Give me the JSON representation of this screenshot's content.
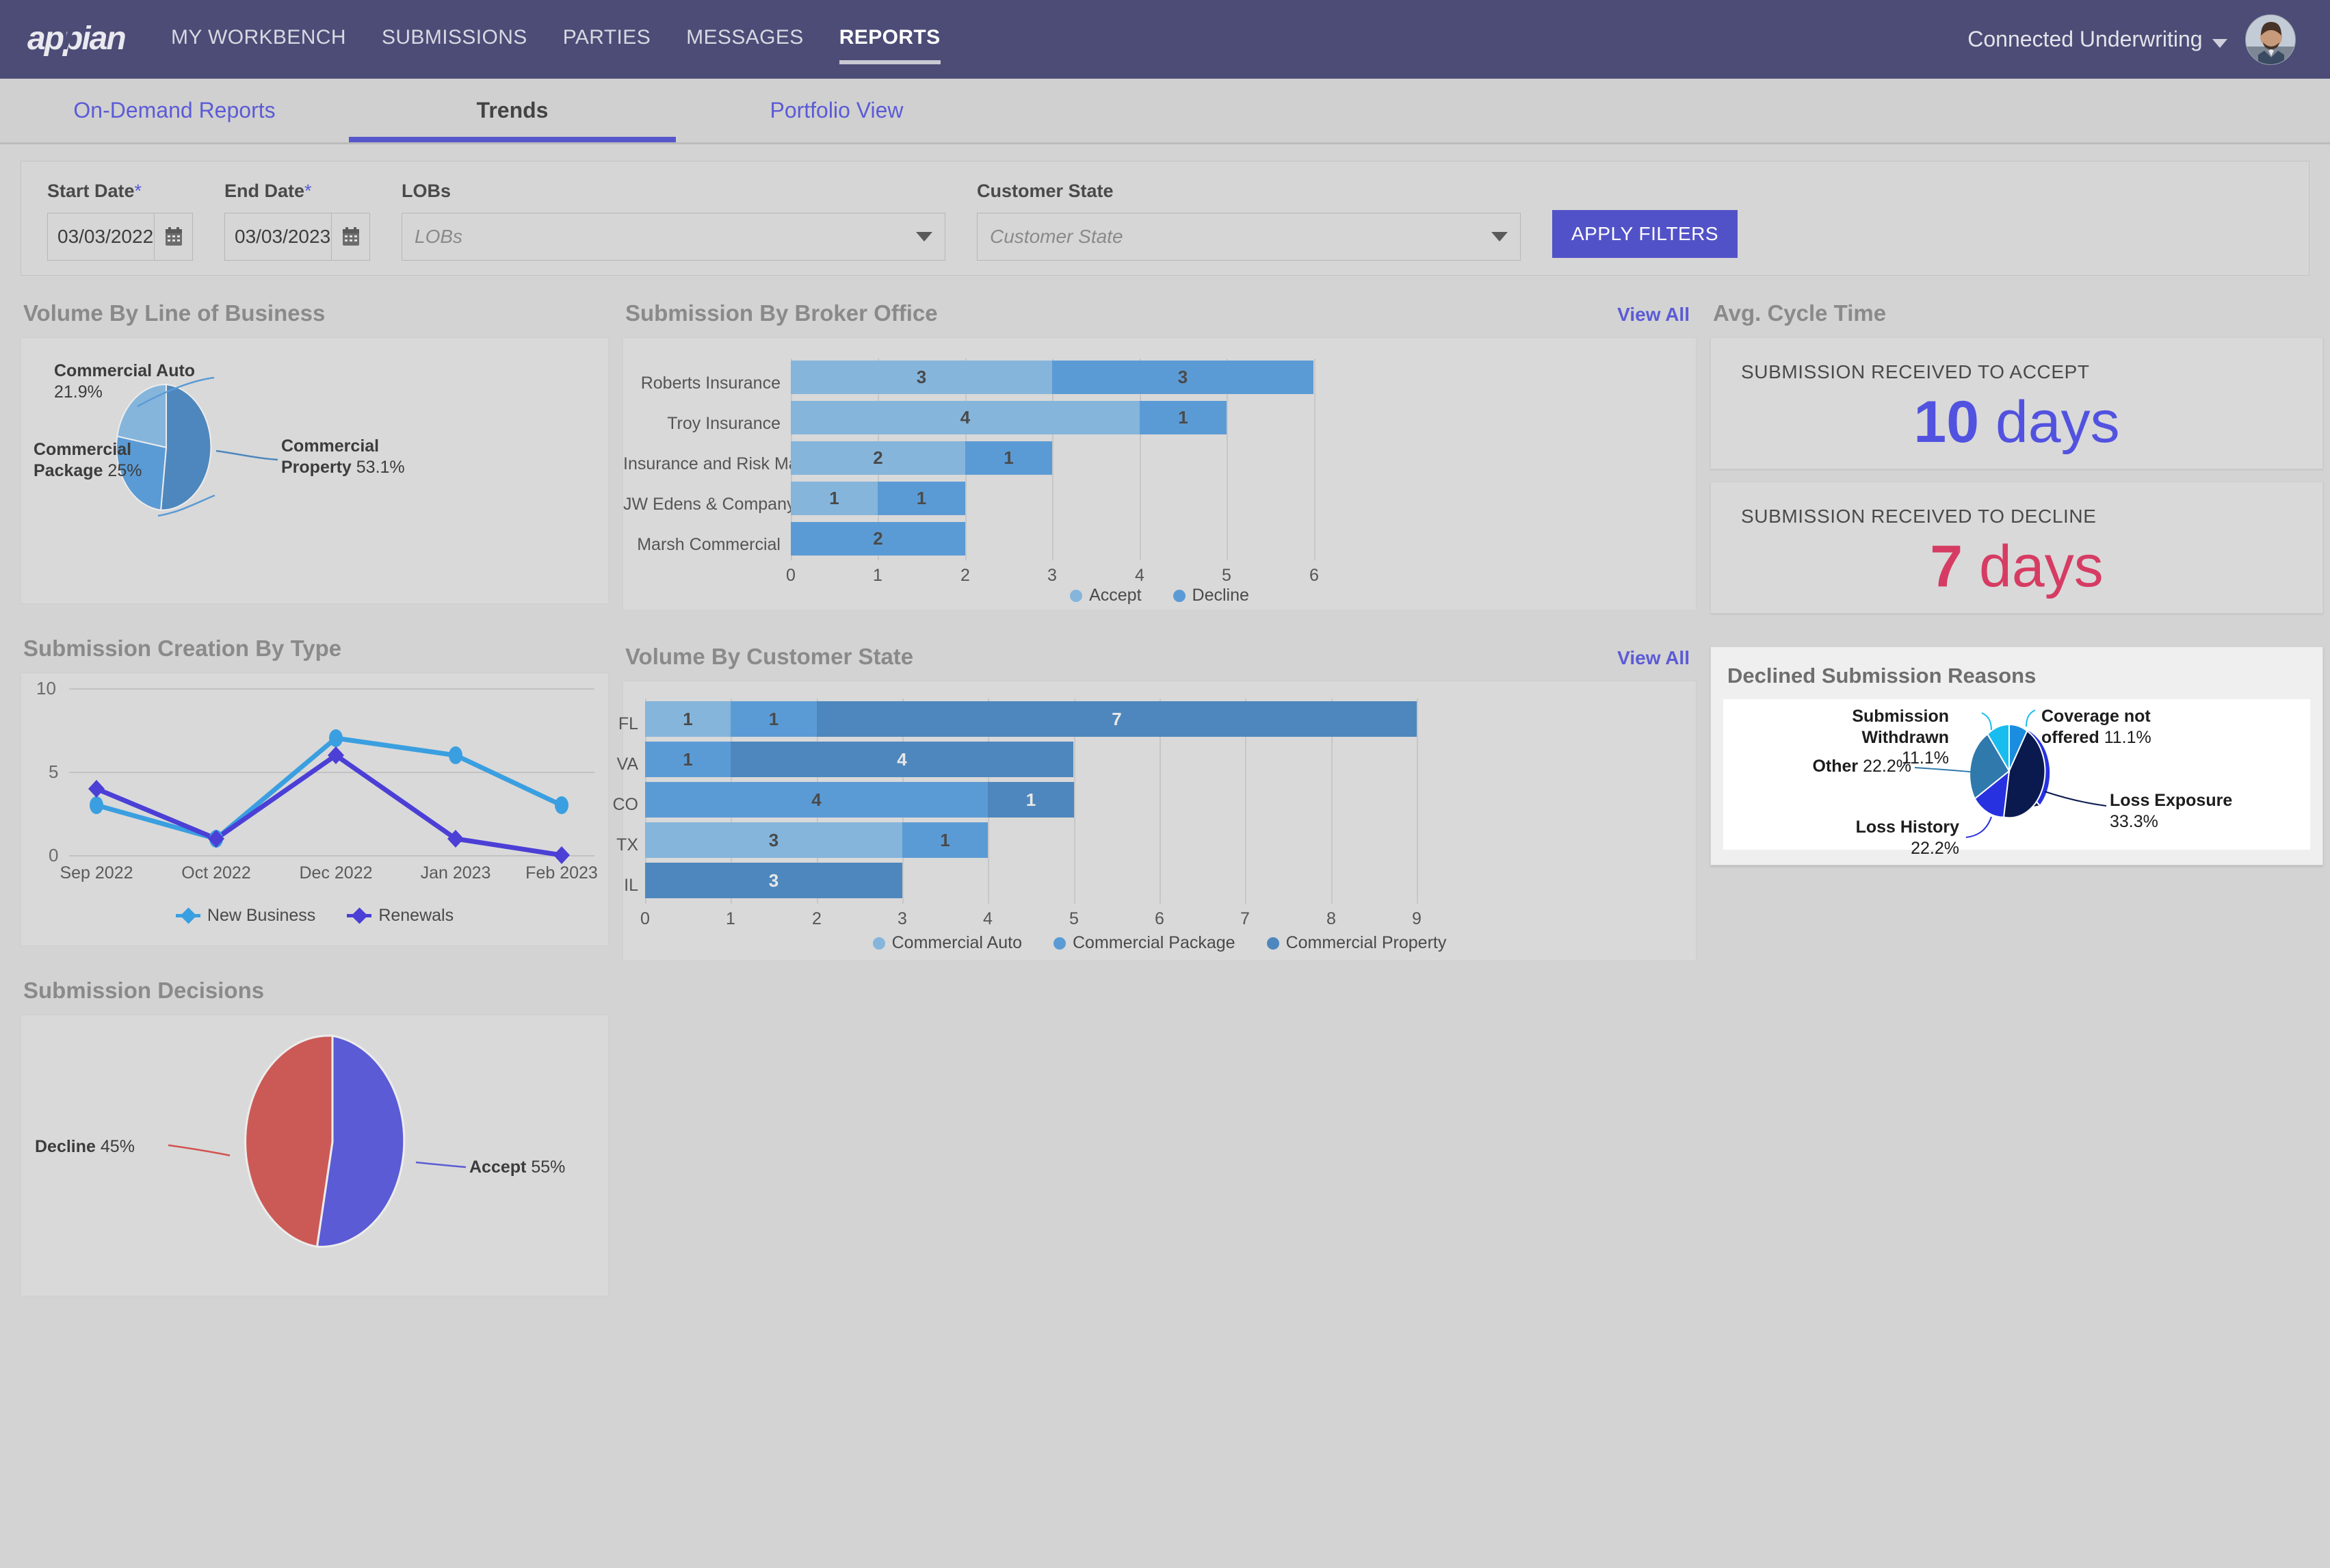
{
  "topnav": {
    "brand": "appian",
    "links": [
      {
        "label": "MY WORKBENCH",
        "active": false
      },
      {
        "label": "SUBMISSIONS",
        "active": false
      },
      {
        "label": "PARTIES",
        "active": false
      },
      {
        "label": "MESSAGES",
        "active": false
      },
      {
        "label": "REPORTS",
        "active": true
      }
    ],
    "org_name": "Connected Underwriting",
    "avatar_alt": "user-avatar"
  },
  "tabs": [
    {
      "label": "On-Demand Reports",
      "active": false
    },
    {
      "label": "Trends",
      "active": true
    },
    {
      "label": "Portfolio View",
      "active": false
    }
  ],
  "filters": {
    "start_date": {
      "label": "Start Date",
      "required": "*",
      "value": "03/03/2022"
    },
    "end_date": {
      "label": "End Date",
      "required": "*",
      "value": "03/03/2023"
    },
    "lobs": {
      "label": "LOBs",
      "placeholder": "LOBs",
      "value": ""
    },
    "customer_state": {
      "label": "Customer State",
      "placeholder": "Customer State",
      "value": ""
    },
    "apply_label": "APPLY FILTERS"
  },
  "cards": {
    "volume_lob": "Volume By Line of Business",
    "submission_creation": "Submission Creation By Type",
    "submission_decisions": "Submission Decisions",
    "broker_office": "Submission By Broker Office",
    "customer_state": "Volume By Customer State",
    "cycle_time": "Avg. Cycle Time",
    "declined_reasons": "Declined Submission Reasons",
    "view_all": "View All"
  },
  "kpis": [
    {
      "label": "SUBMISSION RECEIVED TO ACCEPT",
      "value": "10",
      "unit": "days",
      "color": "#5252e0"
    },
    {
      "label": "SUBMISSION RECEIVED TO DECLINE",
      "value": "7",
      "unit": "days",
      "color": "#d63c63"
    }
  ],
  "chart_data": [
    {
      "id": "volume_by_lob",
      "type": "pie",
      "title": "Volume By Line of Business",
      "labels": [
        "Commercial Property",
        "Commercial Package",
        "Commercial Auto"
      ],
      "values": [
        53.1,
        25,
        21.9
      ],
      "value_labels": [
        "53.1%",
        "25%",
        "21.9%"
      ],
      "colors": [
        "#4e87bd",
        "#5b9bd5",
        "#85b5db"
      ],
      "legend": "none"
    },
    {
      "id": "submission_creation_by_type",
      "type": "line",
      "title": "Submission Creation By Type",
      "x": [
        "Sep 2022",
        "Oct 2022",
        "Dec 2022",
        "Jan 2023",
        "Feb 2023"
      ],
      "series": [
        {
          "name": "New Business",
          "values": [
            3,
            1,
            7,
            6,
            3
          ],
          "color": "#3a9fe0"
        },
        {
          "name": "Renewals",
          "values": [
            4,
            1,
            6,
            1,
            0
          ],
          "color": "#4b3fd6"
        }
      ],
      "ylim": [
        0,
        10
      ],
      "yticks": [
        0,
        5,
        10
      ],
      "ylabel": "",
      "xlabel": "",
      "grid": true,
      "legend": "bottom"
    },
    {
      "id": "submission_decisions",
      "type": "pie",
      "title": "Submission Decisions",
      "labels": [
        "Accept",
        "Decline"
      ],
      "values": [
        55,
        45
      ],
      "value_labels": [
        "55%",
        "45%"
      ],
      "colors": [
        "#5b5bd6",
        "#cb5a56"
      ],
      "legend": "none"
    },
    {
      "id": "submission_by_broker_office",
      "type": "bar",
      "orientation": "horizontal",
      "stacked": true,
      "title": "Submission By Broker Office",
      "categories": [
        "Roberts Insurance",
        "Troy Insurance",
        "Insurance and Risk Management Services, Inc.",
        "JW Edens & Company",
        "Marsh Commercial"
      ],
      "series": [
        {
          "name": "Accept",
          "values": [
            3,
            4,
            2,
            1,
            0
          ],
          "color": "#85b5db"
        },
        {
          "name": "Decline",
          "values": [
            3,
            1,
            1,
            1,
            2
          ],
          "color": "#5b9bd5"
        }
      ],
      "xlim": [
        0,
        6
      ],
      "xticks": [
        0,
        1,
        2,
        3,
        4,
        5,
        6
      ],
      "grid": true,
      "legend": "bottom"
    },
    {
      "id": "volume_by_customer_state",
      "type": "bar",
      "orientation": "horizontal",
      "stacked": true,
      "title": "Volume By Customer State",
      "categories": [
        "FL",
        "VA",
        "CO",
        "TX",
        "IL"
      ],
      "series": [
        {
          "name": "Commercial Auto",
          "values": [
            1,
            0,
            0,
            3,
            0
          ],
          "color": "#85b5db"
        },
        {
          "name": "Commercial Package",
          "values": [
            1,
            1,
            4,
            1,
            0
          ],
          "color": "#5b9bd5"
        },
        {
          "name": "Commercial Property",
          "values": [
            7,
            4,
            1,
            0,
            3
          ],
          "color": "#4e87bd"
        }
      ],
      "xlim": [
        0,
        9
      ],
      "xticks": [
        0,
        1,
        2,
        3,
        4,
        5,
        6,
        7,
        8,
        9
      ],
      "grid": true,
      "legend": "bottom"
    },
    {
      "id": "declined_submission_reasons",
      "type": "pie",
      "title": "Declined Submission Reasons",
      "labels": [
        "Loss Exposure",
        "Loss History",
        "Other",
        "Submission Withdrawn",
        "Coverage not offered"
      ],
      "values": [
        33.3,
        22.2,
        22.2,
        11.1,
        11.1
      ],
      "value_labels": [
        "33.3%",
        "22.2%",
        "22.2%",
        "11.1%",
        "11.1%"
      ],
      "colors": [
        "#0b1a4e",
        "#2731e0",
        "#2f79ac",
        "#18bdf0",
        "#1a8de0"
      ],
      "legend": "none"
    }
  ]
}
